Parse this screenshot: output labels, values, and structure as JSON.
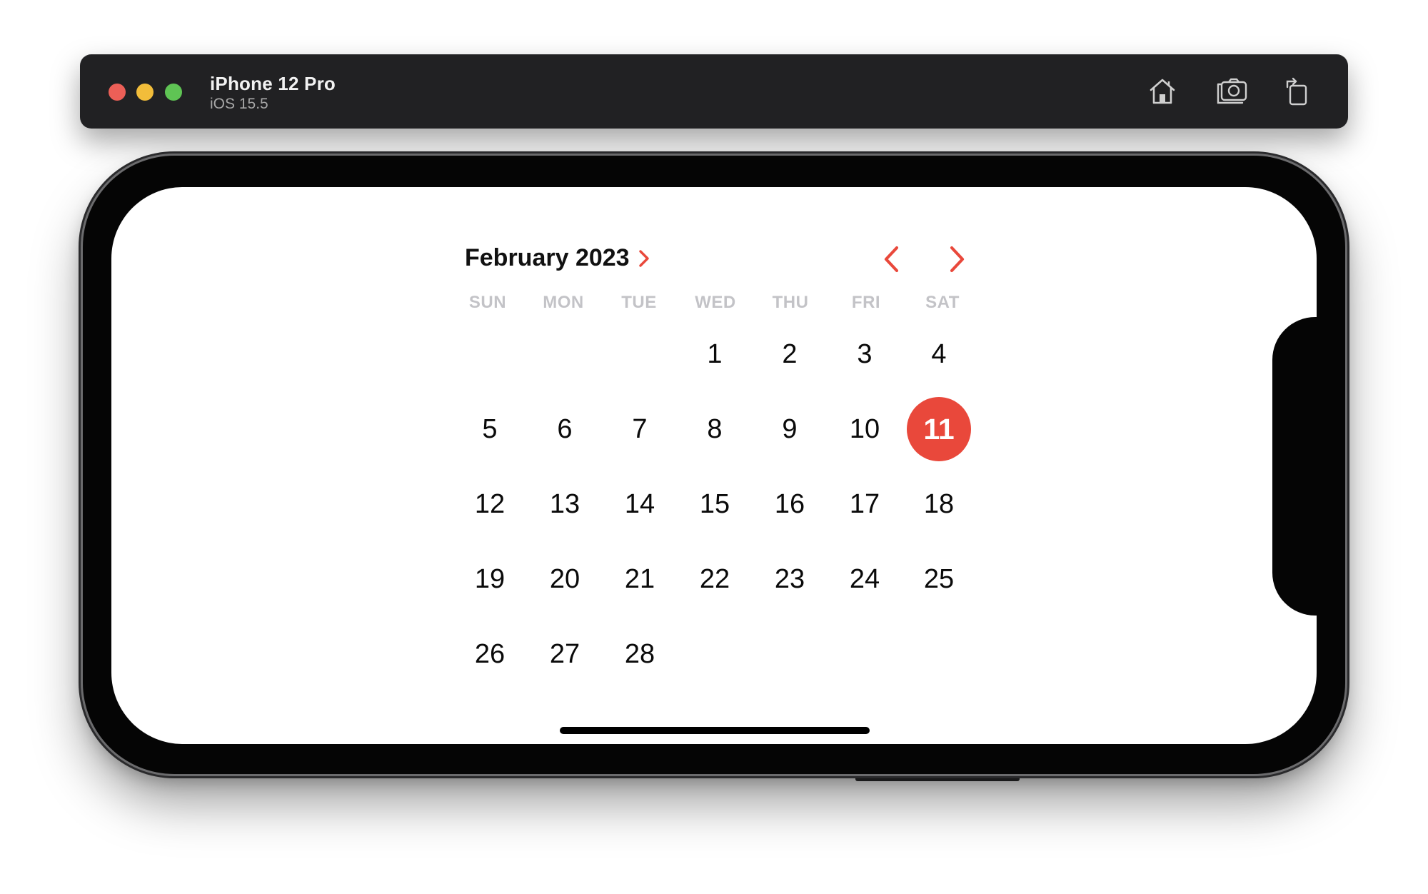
{
  "window": {
    "device_name": "iPhone 12 Pro",
    "os_version": "iOS 15.5",
    "buttons": [
      "home-icon",
      "screenshot-icon",
      "rotate-icon"
    ]
  },
  "calendar": {
    "month_label": "February 2023",
    "weekdays": [
      "SUN",
      "MON",
      "TUE",
      "WED",
      "THU",
      "FRI",
      "SAT"
    ],
    "weeks": [
      [
        "",
        "",
        "",
        "1",
        "2",
        "3",
        "4"
      ],
      [
        "5",
        "6",
        "7",
        "8",
        "9",
        "10",
        "11"
      ],
      [
        "12",
        "13",
        "14",
        "15",
        "16",
        "17",
        "18"
      ],
      [
        "19",
        "20",
        "21",
        "22",
        "23",
        "24",
        "25"
      ],
      [
        "26",
        "27",
        "28",
        "",
        "",
        "",
        ""
      ]
    ],
    "selected_day": "11"
  },
  "colors": {
    "accent": "#e9483b",
    "titlebar": "#212123",
    "weekday_text": "#c3c3c7"
  }
}
